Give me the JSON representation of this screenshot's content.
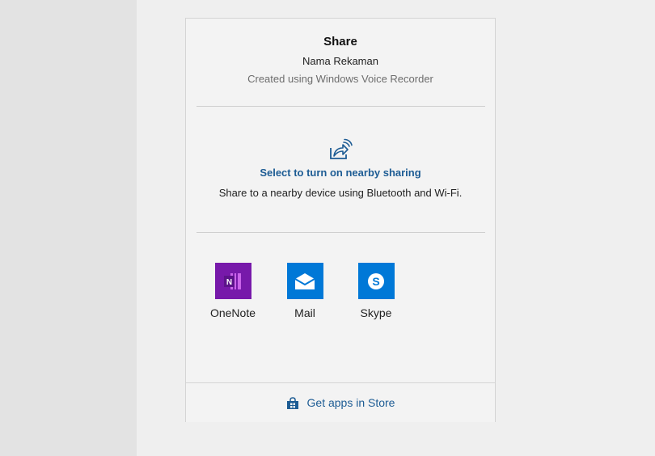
{
  "header": {
    "title": "Share",
    "file_name": "Nama Rekaman",
    "subtitle": "Created using Windows Voice Recorder"
  },
  "nearby": {
    "icon": "nearby-share-icon",
    "link_label": "Select to turn on nearby sharing",
    "description": "Share to a nearby device using Bluetooth and Wi-Fi."
  },
  "apps": [
    {
      "label": "OneNote",
      "icon": "onenote-icon",
      "color": "#7719aa"
    },
    {
      "label": "Mail",
      "icon": "mail-icon",
      "color": "#0078d7"
    },
    {
      "label": "Skype",
      "icon": "skype-icon",
      "color": "#0078d7"
    }
  ],
  "footer": {
    "store_label": "Get apps in Store",
    "store_icon": "store-bag-icon"
  },
  "colors": {
    "link": "#1d5c94",
    "panel_background": "#f3f3f3",
    "page_background": "#efefef"
  }
}
